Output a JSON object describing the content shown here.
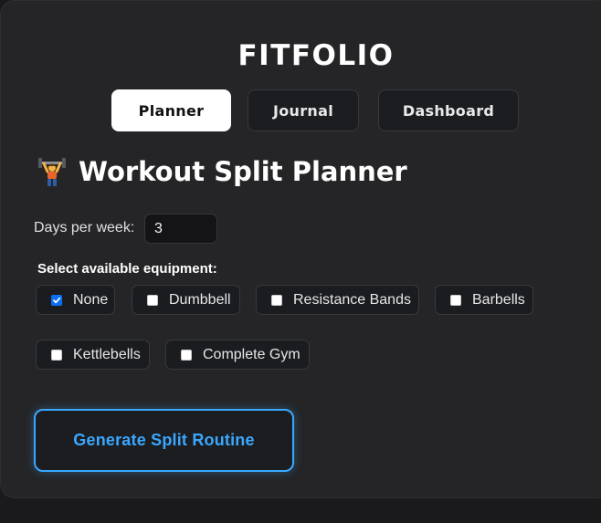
{
  "app": {
    "name": "FITFOLIO"
  },
  "tabs": [
    {
      "label": "Planner",
      "active": true
    },
    {
      "label": "Journal",
      "active": false
    },
    {
      "label": "Dashboard",
      "active": false
    }
  ],
  "planner": {
    "title": "Workout Split Planner",
    "title_icon": "weightlifter-emoji-icon",
    "days_label": "Days per week:",
    "days_value": "3",
    "equipment_label": "Select available equipment:",
    "equipment": [
      {
        "label": "None",
        "checked": true
      },
      {
        "label": "Dumbbell",
        "checked": false
      },
      {
        "label": "Resistance Bands",
        "checked": false
      },
      {
        "label": "Barbells",
        "checked": false
      },
      {
        "label": "Kettlebells",
        "checked": false
      },
      {
        "label": "Complete Gym",
        "checked": false
      }
    ],
    "generate_label": "Generate Split Routine"
  },
  "colors": {
    "background": "#1a1a1c",
    "card": "#252527",
    "accent": "#3aa8ff",
    "checkbox_checked": "#0a6ef7",
    "active_tab_bg": "#ffffff"
  }
}
